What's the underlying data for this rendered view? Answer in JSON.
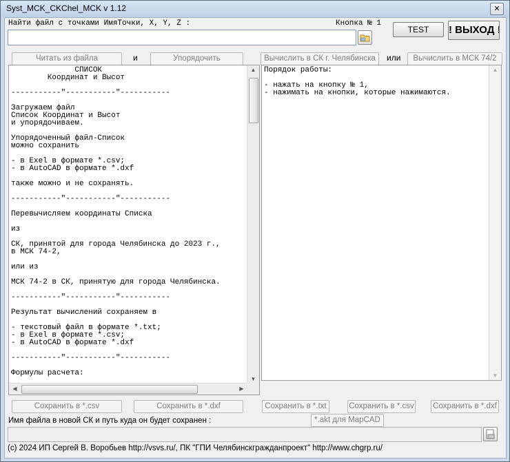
{
  "window": {
    "title": "Syst_MCK_CKChel_MCK v 1.12",
    "close_glyph": "✕"
  },
  "top": {
    "find_file_label": "Найти файл с точками ИмяТочки, X, Y, Z :",
    "button_no1_label": "Кнопка № 1",
    "test_label": "TEST",
    "exit_label": "! ВЫХОД !",
    "file_path_value": ""
  },
  "toolbar": {
    "read_file_label": "Читать из файла",
    "and_label": "и",
    "order_label": "Упорядочить",
    "calc_sk_label": "Вычислить в СК г. Челябинска",
    "or_label": "или",
    "calc_msk_label": "Вычислить в МСК 74/2"
  },
  "left_memo": {
    "text": "              СПИСОК\n        Координат и Высот\n\n-----------\"-----------\"-----------\n\nЗагружаем файл\nСписок Координат и Высот\nи упорядочиваем.\n\nУпорядоченный файл-Список\nможно сохранить\n\n- в Exel в формате *.csv;\n- в AutoCAD в формате *.dxf\n\nтакже можно и не сохранять.\n\n-----------\"-----------\"-----------\n\nПеревычисляем координаты Списка\n\nиз\n\nСК, принятой для города Челябинска до 2023 г.,\nв МСК 74-2,\n\nили из\n\nМСК 74-2 в СК, принятую для города Челябинска.\n\n-----------\"-----------\"-----------\n\nРезультат вычислений сохраняем в\n\n- текстовый файл в формате *.txt;\n- в Exel в формате *.csv;\n- в AutoCAD в формате *.dxf\n\n-----------\"-----------\"-----------\n\nФормулы расчета:"
  },
  "right_memo": {
    "text": "Порядок работы:\n\n- нажать на кнопку № 1,\n- нажимать на кнопки, которые нажимаются."
  },
  "save_buttons": {
    "left_csv": "Сохранить в *.csv",
    "left_dxf": "Сохранить в *.dxf",
    "right_txt": "Сохранить в *.txt",
    "right_csv": "Сохранить в *.csv",
    "right_dxf": "Сохранить в *.dxf",
    "akt_mapcad": "*.akt для MapCAD"
  },
  "bottom": {
    "new_file_label": "Имя файла в новой СК и путь куда он будет сохранен :",
    "new_file_value": "",
    "copyright": "(c) 2024 ИП Сергей В. Воробьев http://vsvs.ru/,  ПК \"ГПИ Челябинскгражданпроект\"  http://www.chgrp.ru/"
  },
  "colors": {
    "window_frame": "#c9d9ea",
    "client_bg": "#f0f0f0",
    "disabled_text": "#7d7d7d"
  }
}
